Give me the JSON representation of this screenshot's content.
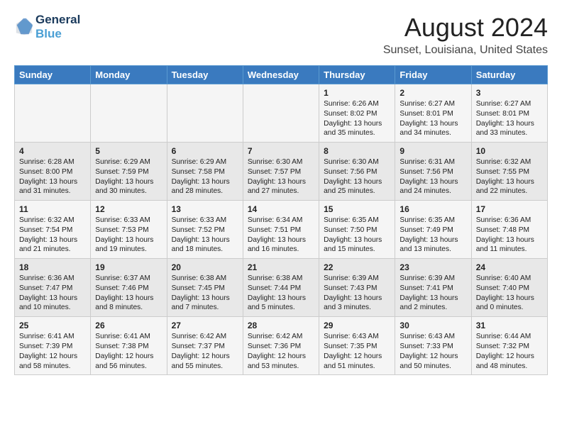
{
  "header": {
    "logo_line1": "General",
    "logo_line2": "Blue",
    "title": "August 2024",
    "subtitle": "Sunset, Louisiana, United States"
  },
  "days_of_week": [
    "Sunday",
    "Monday",
    "Tuesday",
    "Wednesday",
    "Thursday",
    "Friday",
    "Saturday"
  ],
  "weeks": [
    [
      {
        "day": "",
        "content": ""
      },
      {
        "day": "",
        "content": ""
      },
      {
        "day": "",
        "content": ""
      },
      {
        "day": "",
        "content": ""
      },
      {
        "day": "1",
        "content": "Sunrise: 6:26 AM\nSunset: 8:02 PM\nDaylight: 13 hours\nand 35 minutes."
      },
      {
        "day": "2",
        "content": "Sunrise: 6:27 AM\nSunset: 8:01 PM\nDaylight: 13 hours\nand 34 minutes."
      },
      {
        "day": "3",
        "content": "Sunrise: 6:27 AM\nSunset: 8:01 PM\nDaylight: 13 hours\nand 33 minutes."
      }
    ],
    [
      {
        "day": "4",
        "content": "Sunrise: 6:28 AM\nSunset: 8:00 PM\nDaylight: 13 hours\nand 31 minutes."
      },
      {
        "day": "5",
        "content": "Sunrise: 6:29 AM\nSunset: 7:59 PM\nDaylight: 13 hours\nand 30 minutes."
      },
      {
        "day": "6",
        "content": "Sunrise: 6:29 AM\nSunset: 7:58 PM\nDaylight: 13 hours\nand 28 minutes."
      },
      {
        "day": "7",
        "content": "Sunrise: 6:30 AM\nSunset: 7:57 PM\nDaylight: 13 hours\nand 27 minutes."
      },
      {
        "day": "8",
        "content": "Sunrise: 6:30 AM\nSunset: 7:56 PM\nDaylight: 13 hours\nand 25 minutes."
      },
      {
        "day": "9",
        "content": "Sunrise: 6:31 AM\nSunset: 7:56 PM\nDaylight: 13 hours\nand 24 minutes."
      },
      {
        "day": "10",
        "content": "Sunrise: 6:32 AM\nSunset: 7:55 PM\nDaylight: 13 hours\nand 22 minutes."
      }
    ],
    [
      {
        "day": "11",
        "content": "Sunrise: 6:32 AM\nSunset: 7:54 PM\nDaylight: 13 hours\nand 21 minutes."
      },
      {
        "day": "12",
        "content": "Sunrise: 6:33 AM\nSunset: 7:53 PM\nDaylight: 13 hours\nand 19 minutes."
      },
      {
        "day": "13",
        "content": "Sunrise: 6:33 AM\nSunset: 7:52 PM\nDaylight: 13 hours\nand 18 minutes."
      },
      {
        "day": "14",
        "content": "Sunrise: 6:34 AM\nSunset: 7:51 PM\nDaylight: 13 hours\nand 16 minutes."
      },
      {
        "day": "15",
        "content": "Sunrise: 6:35 AM\nSunset: 7:50 PM\nDaylight: 13 hours\nand 15 minutes."
      },
      {
        "day": "16",
        "content": "Sunrise: 6:35 AM\nSunset: 7:49 PM\nDaylight: 13 hours\nand 13 minutes."
      },
      {
        "day": "17",
        "content": "Sunrise: 6:36 AM\nSunset: 7:48 PM\nDaylight: 13 hours\nand 11 minutes."
      }
    ],
    [
      {
        "day": "18",
        "content": "Sunrise: 6:36 AM\nSunset: 7:47 PM\nDaylight: 13 hours\nand 10 minutes."
      },
      {
        "day": "19",
        "content": "Sunrise: 6:37 AM\nSunset: 7:46 PM\nDaylight: 13 hours\nand 8 minutes."
      },
      {
        "day": "20",
        "content": "Sunrise: 6:38 AM\nSunset: 7:45 PM\nDaylight: 13 hours\nand 7 minutes."
      },
      {
        "day": "21",
        "content": "Sunrise: 6:38 AM\nSunset: 7:44 PM\nDaylight: 13 hours\nand 5 minutes."
      },
      {
        "day": "22",
        "content": "Sunrise: 6:39 AM\nSunset: 7:43 PM\nDaylight: 13 hours\nand 3 minutes."
      },
      {
        "day": "23",
        "content": "Sunrise: 6:39 AM\nSunset: 7:41 PM\nDaylight: 13 hours\nand 2 minutes."
      },
      {
        "day": "24",
        "content": "Sunrise: 6:40 AM\nSunset: 7:40 PM\nDaylight: 13 hours\nand 0 minutes."
      }
    ],
    [
      {
        "day": "25",
        "content": "Sunrise: 6:41 AM\nSunset: 7:39 PM\nDaylight: 12 hours\nand 58 minutes."
      },
      {
        "day": "26",
        "content": "Sunrise: 6:41 AM\nSunset: 7:38 PM\nDaylight: 12 hours\nand 56 minutes."
      },
      {
        "day": "27",
        "content": "Sunrise: 6:42 AM\nSunset: 7:37 PM\nDaylight: 12 hours\nand 55 minutes."
      },
      {
        "day": "28",
        "content": "Sunrise: 6:42 AM\nSunset: 7:36 PM\nDaylight: 12 hours\nand 53 minutes."
      },
      {
        "day": "29",
        "content": "Sunrise: 6:43 AM\nSunset: 7:35 PM\nDaylight: 12 hours\nand 51 minutes."
      },
      {
        "day": "30",
        "content": "Sunrise: 6:43 AM\nSunset: 7:33 PM\nDaylight: 12 hours\nand 50 minutes."
      },
      {
        "day": "31",
        "content": "Sunrise: 6:44 AM\nSunset: 7:32 PM\nDaylight: 12 hours\nand 48 minutes."
      }
    ]
  ]
}
